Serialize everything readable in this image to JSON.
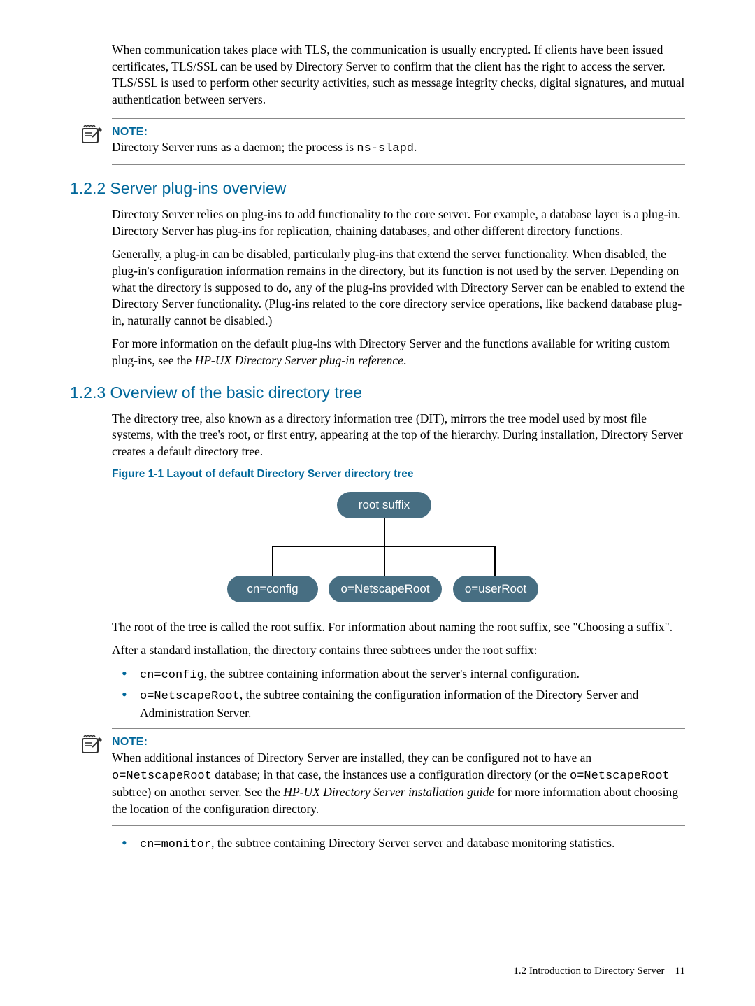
{
  "intro_para": "When communication takes place with TLS, the communication is usually encrypted. If clients have been issued certificates, TLS/SSL can be used by Directory Server to confirm that the client has the right to access the server. TLS/SSL is used to perform other security activities, such as message integrity checks, digital signatures, and mutual authentication between servers.",
  "note1": {
    "label": "NOTE:",
    "text_pre": "Directory Server runs as a daemon; the process is ",
    "code": "ns-slapd",
    "text_post": "."
  },
  "h_122": "1.2.2 Server plug-ins overview",
  "p_122_1": "Directory Server relies on plug-ins to add functionality to the core server. For example, a database layer is a plug-in. Directory Server has plug-ins for replication, chaining databases, and other different directory functions.",
  "p_122_2": "Generally, a plug-in can be disabled, particularly plug-ins that extend the server functionality. When disabled, the plug-in's configuration information remains in the directory, but its function is not used by the server. Depending on what the directory is supposed to do, any of the plug-ins provided with Directory Server can be enabled to extend the Directory Server functionality. (Plug-ins related to the core directory service operations, like backend database plug-in, naturally cannot be disabled.)",
  "p_122_3_pre": "For more information on the default plug-ins with Directory Server and the functions available for writing custom plug-ins, see the ",
  "p_122_3_ital": "HP-UX Directory Server plug-in reference",
  "p_122_3_post": ".",
  "h_123": "1.2.3 Overview of the basic directory tree",
  "p_123_1": "The directory tree, also known as a directory information tree (DIT), mirrors the tree model used by most file systems, with the tree's root, or first entry, appearing at the top of the hierarchy. During installation, Directory Server creates a default directory tree.",
  "figure_caption": "Figure 1-1 Layout of default Directory Server directory tree",
  "chart_data": {
    "type": "tree",
    "root": "root suffix",
    "children": [
      "cn=config",
      "o=NetscapeRoot",
      "o=userRoot"
    ]
  },
  "p_123_2_pre": "The root of the tree is called the root suffix. For information about naming the root suffix, see ",
  "p_123_2_link": "\"Choosing a suffix\"",
  "p_123_2_post": ".",
  "p_123_3": "After a standard installation, the directory contains three subtrees under the root suffix:",
  "bullets1": [
    {
      "code": "cn=config",
      "text": ", the subtree containing information about the server's internal configuration."
    },
    {
      "code": "o=NetscapeRoot",
      "text": ", the subtree containing the configuration information of the Directory Server and Administration Server."
    }
  ],
  "note2": {
    "label": "NOTE:",
    "t1": "When additional instances of Directory Server are installed, they can be configured not to have an ",
    "c1": "o=NetscapeRoot",
    "t2": " database; in that case, the instances use a configuration directory (or the ",
    "c2": "o=NetscapeRoot",
    "t3": " subtree) on another server. See the ",
    "ital": "HP-UX Directory Server installation guide",
    "t4": " for more information about choosing the location of the configuration directory."
  },
  "bullets2": [
    {
      "code": "cn=monitor",
      "text": ", the subtree containing Directory Server server and database monitoring statistics."
    }
  ],
  "footer": {
    "section": "1.2 Introduction to Directory Server",
    "page": "11"
  }
}
